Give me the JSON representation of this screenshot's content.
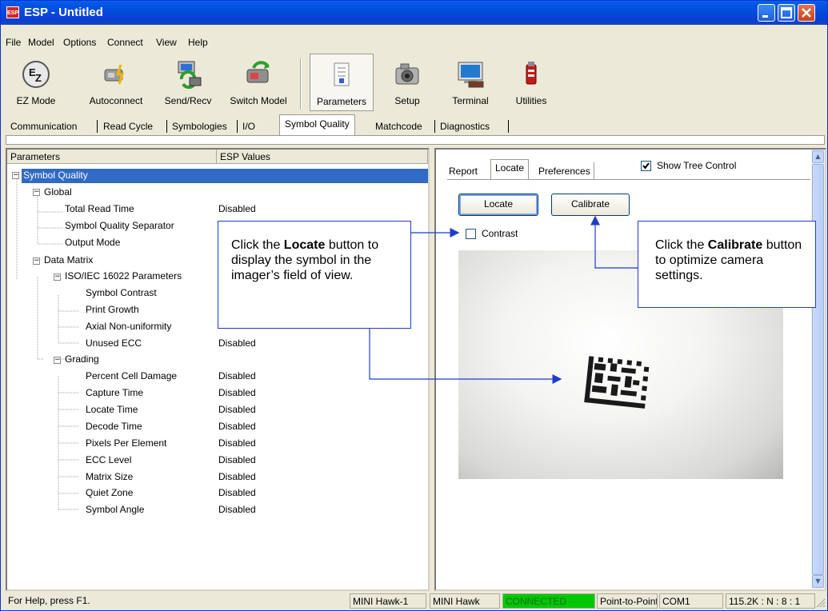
{
  "window": {
    "title": "ESP - Untitled",
    "app_icon": "ESP",
    "controls": [
      "minimize-icon",
      "maximize-icon",
      "close-icon"
    ]
  },
  "menu": [
    "File",
    "Model",
    "Options",
    "Connect",
    "View",
    "Help"
  ],
  "toolbar": [
    {
      "label": "EZ Mode",
      "icon": "ez-mode-icon"
    },
    {
      "label": "Autoconnect",
      "icon": "autoconnect-icon"
    },
    {
      "label": "Send/Recv",
      "icon": "send-recv-icon"
    },
    {
      "label": "Switch Model",
      "icon": "switch-model-icon"
    },
    {
      "label": "Parameters",
      "icon": "parameters-icon",
      "pressed": true
    },
    {
      "label": "Setup",
      "icon": "camera-setup-icon"
    },
    {
      "label": "Terminal",
      "icon": "terminal-icon"
    },
    {
      "label": "Utilities",
      "icon": "utilities-icon"
    }
  ],
  "tabs": [
    "Communication",
    "Read Cycle",
    "Symbologies",
    "I/O",
    "Symbol Quality",
    "Matchcode",
    "Diagnostics"
  ],
  "active_tab": "Symbol Quality",
  "tree": {
    "headers": {
      "parameters": "Parameters",
      "values": "ESP Values"
    },
    "items": [
      {
        "label": "Symbol Quality",
        "value": "",
        "selected": true
      },
      {
        "label": "Global",
        "value": ""
      },
      {
        "label": "Total Read Time",
        "value": "Disabled"
      },
      {
        "label": "Symbol Quality Separator",
        "value": ""
      },
      {
        "label": "Output Mode",
        "value": ""
      },
      {
        "label": "Data Matrix",
        "value": ""
      },
      {
        "label": "ISO/IEC 16022 Parameters",
        "value": ""
      },
      {
        "label": "Symbol Contrast",
        "value": ""
      },
      {
        "label": "Print Growth",
        "value": ""
      },
      {
        "label": "Axial Non-uniformity",
        "value": ""
      },
      {
        "label": "Unused ECC",
        "value": "Disabled"
      },
      {
        "label": "Grading",
        "value": ""
      },
      {
        "label": "Percent Cell Damage",
        "value": "Disabled"
      },
      {
        "label": "Capture Time",
        "value": "Disabled"
      },
      {
        "label": "Locate Time",
        "value": "Disabled"
      },
      {
        "label": "Decode Time",
        "value": "Disabled"
      },
      {
        "label": "Pixels Per Element",
        "value": "Disabled"
      },
      {
        "label": "ECC Level",
        "value": "Disabled"
      },
      {
        "label": "Matrix Size",
        "value": "Disabled"
      },
      {
        "label": "Quiet Zone",
        "value": "Disabled"
      },
      {
        "label": "Symbol Angle",
        "value": "Disabled"
      }
    ]
  },
  "right": {
    "tabs": [
      "Report",
      "Locate",
      "Preferences"
    ],
    "active_tab": "Locate",
    "show_tree": {
      "label": "Show Tree Control",
      "checked": true
    },
    "locate_button": "Locate",
    "calibrate_button": "Calibrate",
    "contrast": {
      "label": "Contrast",
      "checked": false
    }
  },
  "callouts": {
    "locate": {
      "pre": "Click the ",
      "bold": "Locate",
      "post": " button to display the symbol in the imager’s field of view."
    },
    "calibrate": {
      "pre": "Click the ",
      "bold": "Calibrate",
      "post": " button to optimize camera settings."
    }
  },
  "status": {
    "help": "For Help, press F1.",
    "device": "MINI Hawk-1",
    "model": "MINI Hawk",
    "connection": "CONNECTED",
    "mode": "Point-to-Point",
    "port": "COM1",
    "settings": "115.2K : N : 8 : 1"
  },
  "colors": {
    "title_bar": "#0054e3",
    "connected": "#00c800",
    "selection": "#316ac5",
    "callout_arrow": "#1f3ccb"
  }
}
